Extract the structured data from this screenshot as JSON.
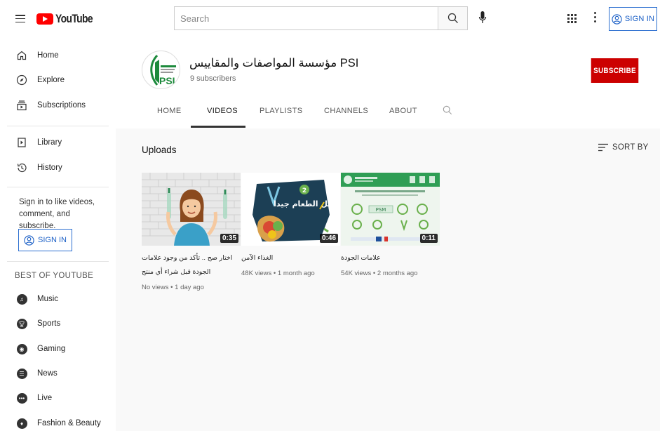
{
  "header": {
    "logo_text": "YouTube",
    "search_placeholder": "Search",
    "signin_label": "SIGN IN"
  },
  "sidebar": {
    "items_top": [
      {
        "label": "Home",
        "icon": "home-icon"
      },
      {
        "label": "Explore",
        "icon": "compass-icon"
      },
      {
        "label": "Subscriptions",
        "icon": "subscriptions-icon"
      }
    ],
    "items_mid": [
      {
        "label": "Library",
        "icon": "library-icon"
      },
      {
        "label": "History",
        "icon": "history-icon"
      }
    ],
    "signin_prompt": "Sign in to like videos, comment, and subscribe.",
    "signin_label": "SIGN IN",
    "best_title": "BEST OF YOUTUBE",
    "best_items": [
      {
        "label": "Music",
        "icon": "music-icon"
      },
      {
        "label": "Sports",
        "icon": "sports-icon"
      },
      {
        "label": "Gaming",
        "icon": "gaming-icon"
      },
      {
        "label": "News",
        "icon": "news-icon"
      },
      {
        "label": "Live",
        "icon": "live-icon"
      },
      {
        "label": "Fashion & Beauty",
        "icon": "fashion-icon"
      }
    ]
  },
  "channel": {
    "name": "مؤسسة المواصفات والمقاييس PSI",
    "subscribers": "9 subscribers",
    "subscribe_label": "SUBSCRIBE",
    "avatar_text": "PSI",
    "tabs": [
      "HOME",
      "VIDEOS",
      "PLAYLISTS",
      "CHANNELS",
      "ABOUT"
    ],
    "active_tab": "VIDEOS"
  },
  "content": {
    "section_title": "Uploads",
    "sort_label": "SORT BY",
    "videos": [
      {
        "title": "اختار صح .. تأكد من وجود علامات الجودة قبل شراء أي منتج",
        "meta": "No views • 1 day ago",
        "duration": "0:35"
      },
      {
        "title": "الغذاء الآمن",
        "meta": "48K views • 1 month ago",
        "duration": "0:46",
        "thumb_text": "غسل الطعام جيدا"
      },
      {
        "title": "علامات الجودة",
        "meta": "54K views • 2 months ago",
        "duration": "0:11",
        "thumb_text": "PSM"
      }
    ]
  },
  "colors": {
    "brand_red": "#ff0000",
    "subscribe_red": "#cc0000",
    "signin_blue": "#1a5fc6"
  }
}
